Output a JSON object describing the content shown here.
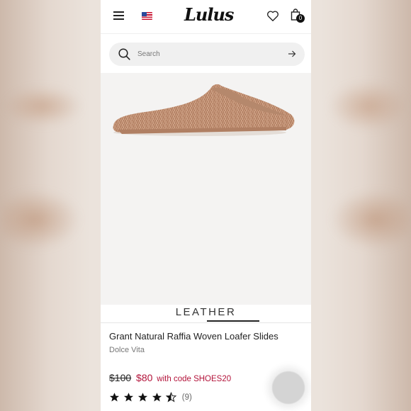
{
  "header": {
    "logo_text": "Lulus",
    "cart_count": "0"
  },
  "search": {
    "placeholder": "Search"
  },
  "carousel": {
    "label": "LEATHER"
  },
  "product": {
    "name": "Grant Natural Raffia Woven Loafer Slides",
    "brand": "Dolce Vita",
    "price_original": "$100",
    "price_sale": "$80",
    "promo_text": "with code SHOES20",
    "rating_stars": 4.5,
    "review_count": "(9)"
  },
  "colors": {
    "sale_red": "#b3133a",
    "shoe_tan": "#c99a7e",
    "text_dark": "#222222"
  },
  "icons": [
    "menu-icon",
    "us-flag-icon",
    "heart-icon",
    "shopping-bag-icon",
    "search-icon",
    "arrow-right-icon",
    "star-icon"
  ]
}
